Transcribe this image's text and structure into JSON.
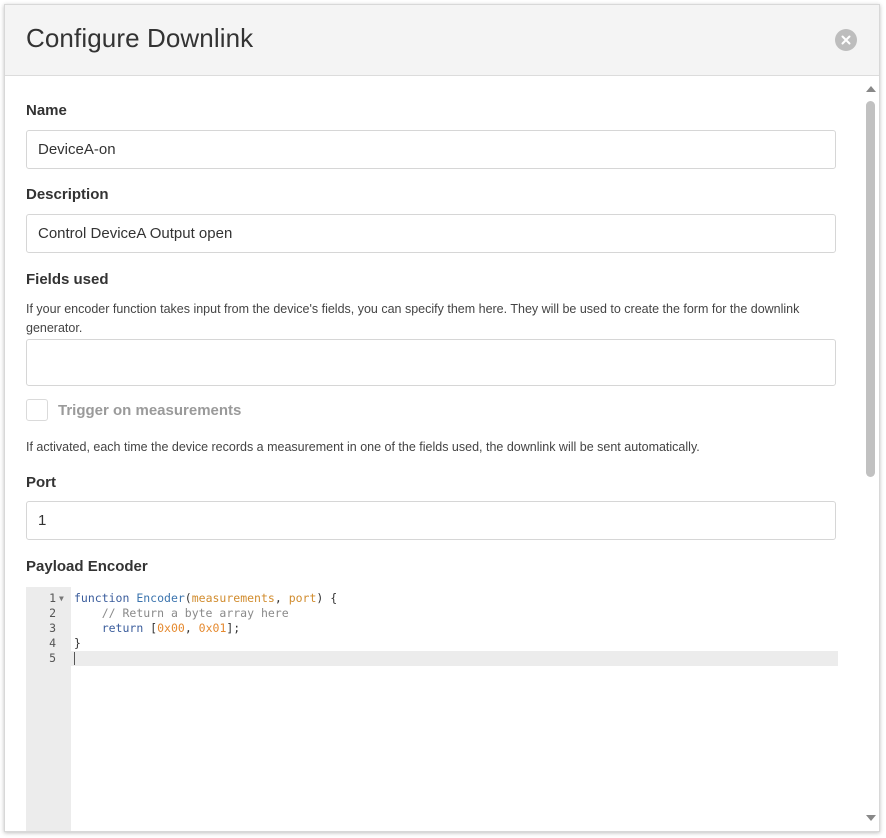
{
  "modal": {
    "title": "Configure Downlink"
  },
  "form": {
    "name_label": "Name",
    "name_value": "DeviceA-on",
    "description_label": "Description",
    "description_value": "Control DeviceA Output open",
    "fields_used_label": "Fields used",
    "fields_used_help": "If your encoder function takes input from the device's fields, you can specify them here. They will be used to create the form for the downlink generator.",
    "fields_used_value": "",
    "trigger_label": "Trigger on measurements",
    "trigger_checked": false,
    "trigger_help": "If activated, each time the device records a measurement in one of the fields used, the downlink will be sent automatically.",
    "port_label": "Port",
    "port_value": "1",
    "payload_encoder_label": "Payload Encoder"
  },
  "editor": {
    "line_numbers": [
      "1",
      "2",
      "3",
      "4",
      "5"
    ],
    "tokens": {
      "l1_kw": "function",
      "l1_fn": "Encoder",
      "l1_open": "(",
      "l1_p1": "measurements",
      "l1_sep": ", ",
      "l1_p2": "port",
      "l1_close": ") {",
      "l2_comment": "// Return a byte array here",
      "l3_kw": "return",
      "l3_open": " [",
      "l3_n1": "0x00",
      "l3_sep": ", ",
      "l3_n2": "0x01",
      "l3_close": "];",
      "l4_brace": "}"
    }
  },
  "colors": {
    "header_bg": "#f4f4f4",
    "keyword": "#3b5d9c",
    "function_name": "#3b74ae",
    "parameter": "#d18c2e",
    "comment": "#8a8a8a",
    "number": "#e5892e",
    "close_icon_bg": "#bdbdbd"
  },
  "icons": {
    "close": "close-circle-icon",
    "fold": "fold-arrow-icon",
    "scroll_up": "chevron-up-icon",
    "scroll_down": "chevron-down-icon"
  }
}
